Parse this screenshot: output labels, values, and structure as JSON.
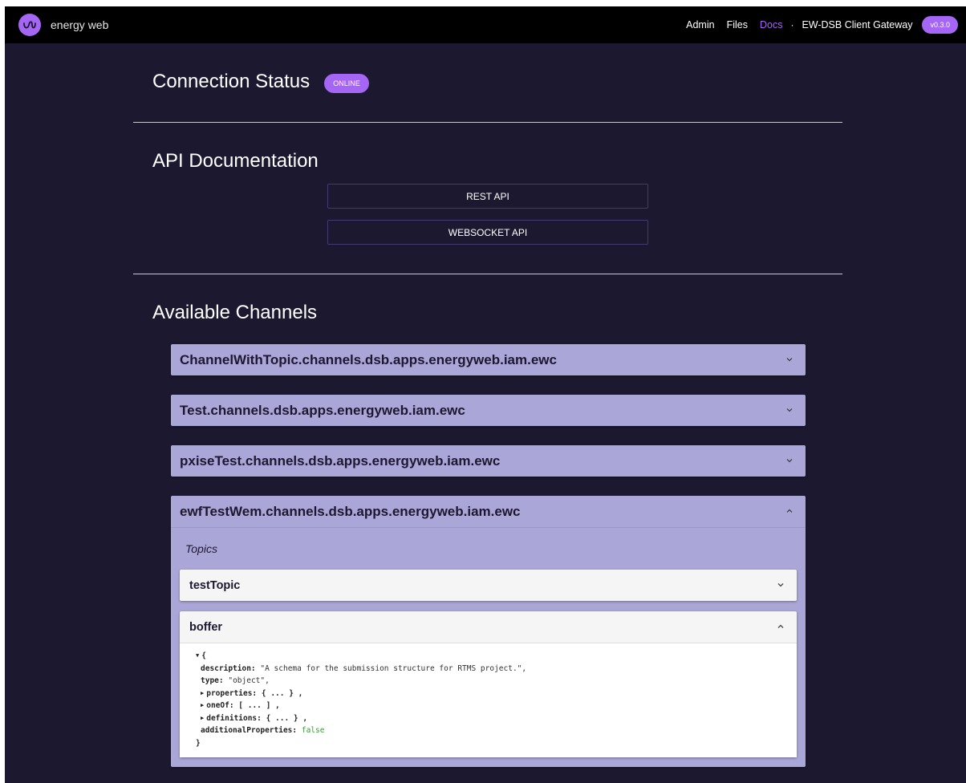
{
  "header": {
    "brand": "energy web",
    "nav": [
      "Admin",
      "Files",
      "Docs"
    ],
    "active_nav": "Docs",
    "separator": "·",
    "gateway": "EW-DSB Client Gateway",
    "version": "v0.3.0"
  },
  "connection": {
    "title": "Connection Status",
    "status": "ONLINE"
  },
  "api_docs": {
    "title": "API Documentation",
    "rest_label": "REST API",
    "ws_label": "WEBSOCKET API"
  },
  "channels": {
    "title": "Available Channels",
    "items": [
      {
        "name": "ChannelWithTopic.channels.dsb.apps.energyweb.iam.ewc",
        "expanded": false
      },
      {
        "name": "Test.channels.dsb.apps.energyweb.iam.ewc",
        "expanded": false
      },
      {
        "name": "pxiseTest.channels.dsb.apps.energyweb.iam.ewc",
        "expanded": false
      },
      {
        "name": "ewfTestWem.channels.dsb.apps.energyweb.iam.ewc",
        "expanded": true
      }
    ],
    "topics_label": "Topics",
    "topics": [
      {
        "name": "testTopic",
        "expanded": false
      },
      {
        "name": "boffer",
        "expanded": true
      }
    ]
  },
  "schema": {
    "open_brace": "{",
    "close_brace": "}",
    "description_key": "description:",
    "description_value": "\"A schema for the submission structure for RTMS project.\",",
    "type_key": "type:",
    "type_value": "\"object\",",
    "properties_key": "properties:",
    "properties_value": "{ ... } ,",
    "oneof_key": "oneOf:",
    "oneof_value": "[ ... ] ,",
    "definitions_key": "definitions:",
    "definitions_value": "{ ... } ,",
    "additional_key": "additionalProperties:",
    "additional_value": "false"
  },
  "colors": {
    "accent": "#a566f5",
    "background": "#1c1830",
    "channel": "#aaa6d8"
  },
  "icons": {
    "logo": "energy-web-logo-icon",
    "expand": "chevron-down-icon",
    "collapse": "chevron-up-icon"
  }
}
